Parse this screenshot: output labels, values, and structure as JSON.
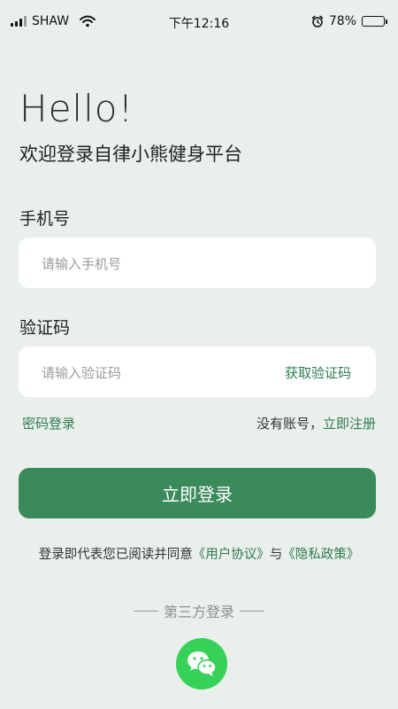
{
  "status_bar": {
    "carrier": "SHAW",
    "time": "下午12:16",
    "battery": "78%",
    "battery_level": 0.78
  },
  "header": {
    "greeting": "Hello!",
    "welcome": "欢迎登录自律小熊健身平台"
  },
  "form": {
    "phone_label": "手机号",
    "phone_placeholder": "请输入手机号",
    "code_label": "验证码",
    "code_placeholder": "请输入验证码",
    "get_code": "获取验证码",
    "password_login": "密码登录",
    "no_account": "没有账号，",
    "register": "立即注册",
    "login_button": "立即登录"
  },
  "agreement": {
    "prefix": "登录即代表您已阅读并同意",
    "user_agreement": "《用户协议》",
    "and": "与",
    "privacy_policy": "《隐私政策》"
  },
  "third_party": {
    "label": "第三方登录",
    "wechat_icon": "wechat-icon"
  },
  "colors": {
    "background": "#e9f0ec",
    "accent": "#3a8a5c",
    "link": "#2f7a4e",
    "wechat": "#35d158"
  }
}
